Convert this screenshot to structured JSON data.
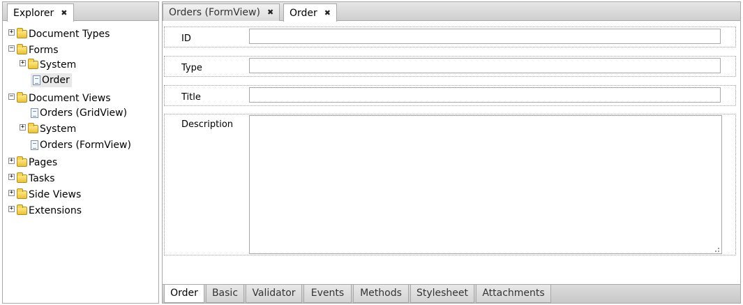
{
  "explorer": {
    "tab_label": "Explorer",
    "close_glyph": "✖",
    "tree": {
      "document_types": "Document Types",
      "forms": "Forms",
      "forms_system": "System",
      "forms_order": "Order",
      "document_views": "Document Views",
      "orders_gridview": "Orders (GridView)",
      "views_system": "System",
      "orders_formview": "Orders (FormView)",
      "pages": "Pages",
      "tasks": "Tasks",
      "side_views": "Side Views",
      "extensions": "Extensions"
    },
    "expand_glyph": "+",
    "collapse_glyph": "−"
  },
  "editor": {
    "tabs": [
      {
        "label": "Orders (FormView)",
        "active": false
      },
      {
        "label": "Order",
        "active": true
      }
    ],
    "close_glyph": "✖",
    "fields": {
      "id": {
        "label": "ID",
        "value": ""
      },
      "type": {
        "label": "Type",
        "value": ""
      },
      "title": {
        "label": "Title",
        "value": ""
      },
      "description": {
        "label": "Description",
        "value": ""
      }
    },
    "bottom_tabs": [
      {
        "label": "Order",
        "active": true
      },
      {
        "label": "Basic",
        "active": false
      },
      {
        "label": "Validator",
        "active": false
      },
      {
        "label": "Events",
        "active": false
      },
      {
        "label": "Methods",
        "active": false
      },
      {
        "label": "Stylesheet",
        "active": false
      },
      {
        "label": "Attachments",
        "active": false
      }
    ]
  },
  "icons": {
    "folder": "folder-icon",
    "document": "document-icon",
    "close": "close-icon",
    "expand": "plus-icon",
    "collapse": "minus-icon"
  },
  "colors": {
    "border": "#a8a8a8",
    "folder": "#e9c23a",
    "selection": "#e8e8e8"
  }
}
